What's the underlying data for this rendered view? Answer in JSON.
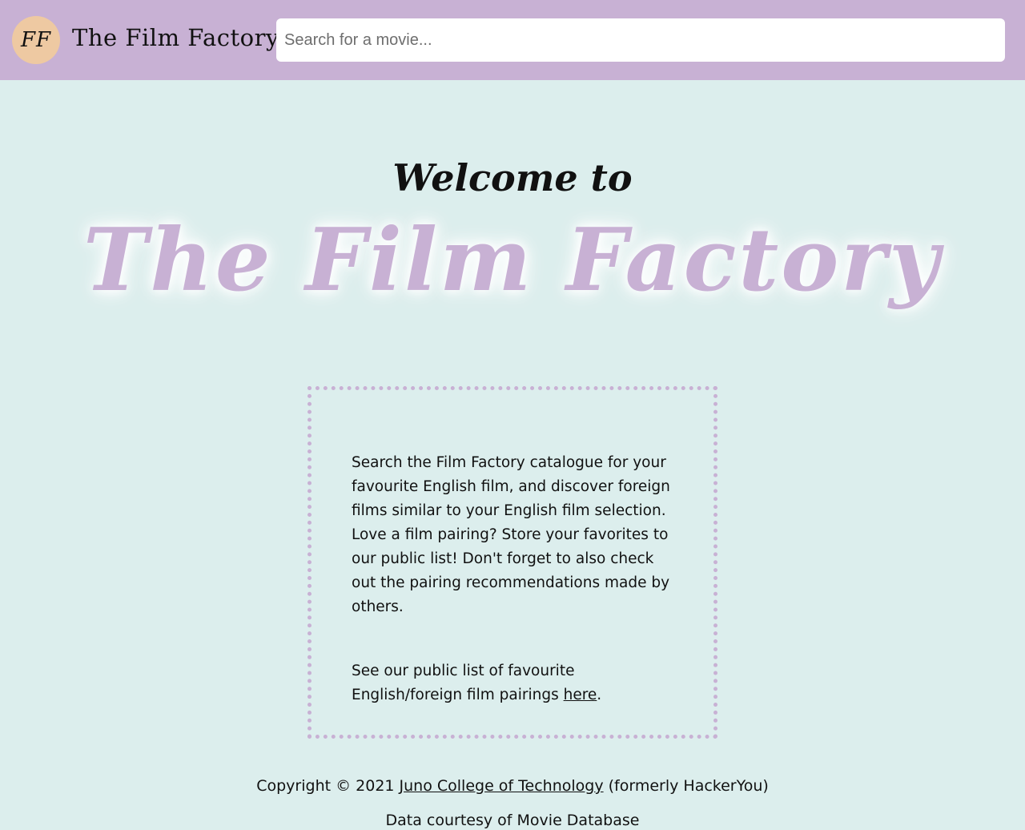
{
  "header": {
    "logo_text": "FF",
    "brand": "The Film Factory",
    "search_placeholder": "Search for a movie...",
    "search_value": ""
  },
  "hero": {
    "welcome": "Welcome to",
    "title": "The Film Factory"
  },
  "info": {
    "paragraph1": "Search the Film Factory catalogue for your favourite English film, and discover foreign films similar to your English film selection. Love a film pairing? Store your favorites to our public list! Don't forget to also check out the pairing recommendations made by others.",
    "paragraph2_prefix": "See our public list of favourite English/foreign film pairings ",
    "paragraph2_link": "here",
    "paragraph2_suffix": "."
  },
  "footer": {
    "copyright_prefix": "Copyright © 2021 ",
    "copyright_link": "Juno College of Technology",
    "copyright_suffix": " (formerly HackerYou)",
    "data_credit": "Data courtesy of Movie Database"
  },
  "colors": {
    "header_bg": "#c8b1d4",
    "page_bg": "#dceeed",
    "logo_bg": "#eec9a2",
    "accent": "#c8b1d4"
  }
}
